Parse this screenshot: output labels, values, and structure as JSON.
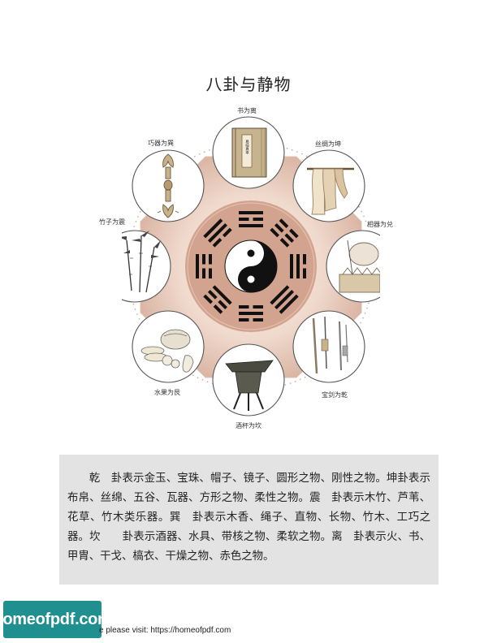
{
  "title": "八卦与静物",
  "labels": {
    "top": "书为离",
    "top_right": "丝绸为坤",
    "right": "相器为兑",
    "bottom_right": "宝剑为乾",
    "bottom": "酒杯为坎",
    "bottom_left": "水果为艮",
    "left": "竹子为震",
    "top_left": "巧器为巽"
  },
  "book_cover_text": "易经真本",
  "paragraph": "乾　卦表示金玉、宝珠、帽子、镜子、圆形之物、刚性之物。坤卦表示布帛、丝绵、五谷、瓦器、方形之物、柔性之物。震　卦表示木竹、芦苇、花草、竹木类乐器。巽　卦表示木香、绳子、直物、长物、竹木、工巧之器。坎　　卦表示酒器、水具、带核之物、柔软之物。离　卦表示火、书、甲胄、干戈、槁衣、干燥之物、赤色之物。",
  "footer": {
    "logo": "homeofpdf.com",
    "text": "e please visit: https://homeofpdf.com"
  },
  "colors": {
    "octagon_fill": "#e6cbbd",
    "center_disc": "#d2a48f",
    "trigram": "#111111",
    "text_box": "#e3e3e3",
    "logo_bg": "#1f8f8f"
  }
}
